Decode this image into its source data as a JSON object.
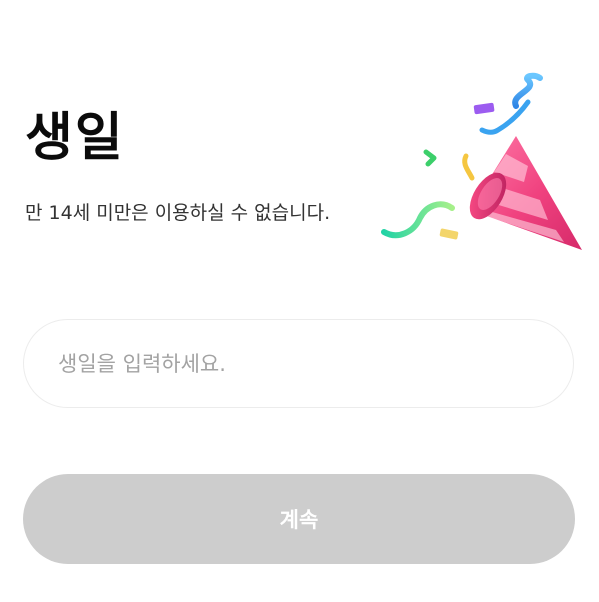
{
  "page": {
    "title": "생일",
    "subtitle": "만 14세 미만은 이용하실 수 없습니다.",
    "illustration_icon": "party-popper-icon"
  },
  "birthday_input": {
    "value": "",
    "placeholder": "생일을 입력하세요."
  },
  "continue_button": {
    "label": "계속",
    "enabled": false
  },
  "colors": {
    "background": "#ffffff",
    "title_text": "#0b0b0b",
    "subtitle_text": "#333333",
    "placeholder_text": "#a3a3a3",
    "input_border": "#ececec",
    "button_disabled_bg": "#cdcdcd",
    "button_text": "#ffffff",
    "popper_pink": "#f0427f"
  }
}
